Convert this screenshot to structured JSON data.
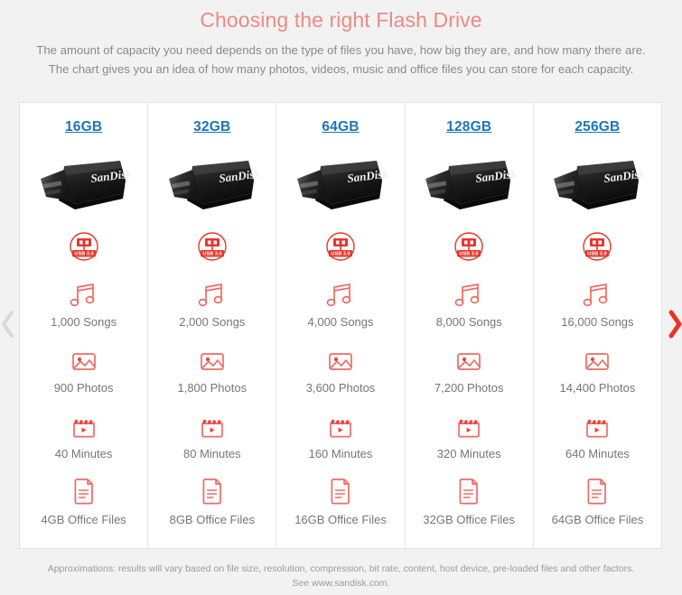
{
  "header": {
    "title": "Choosing the right Flash Drive",
    "subtitle_line1": "The amount of capacity you need depends on the type of files you have, how big they are, and how many there are.",
    "subtitle_line2": "The chart gives you an idea of how many photos, videos, music and office files you can store for each capacity."
  },
  "badge": {
    "usb_label": "USB 3.0"
  },
  "chart_data": {
    "type": "table",
    "title": "Choosing the right Flash Drive",
    "columns": [
      "16GB",
      "32GB",
      "64GB",
      "128GB",
      "256GB"
    ],
    "rows": [
      {
        "icon": "music-note-icon",
        "metric": "Songs",
        "values": [
          "1,000 Songs",
          "2,000 Songs",
          "4,000 Songs",
          "8,000 Songs",
          "16,000 Songs"
        ]
      },
      {
        "icon": "photo-icon",
        "metric": "Photos",
        "values": [
          "900 Photos",
          "1,800 Photos",
          "3,600 Photos",
          "7,200 Photos",
          "14,400 Photos"
        ]
      },
      {
        "icon": "video-clapperboard-icon",
        "metric": "Minutes",
        "values": [
          "40 Minutes",
          "80 Minutes",
          "160 Minutes",
          "320 Minutes",
          "640 Minutes"
        ]
      },
      {
        "icon": "document-icon",
        "metric": "Office Files",
        "values": [
          "4GB Office Files",
          "8GB Office Files",
          "16GB Office Files",
          "32GB Office Files",
          "64GB Office Files"
        ]
      }
    ]
  },
  "columns": [
    {
      "capacity": "16GB",
      "songs": "1,000 Songs",
      "photos": "900 Photos",
      "minutes": "40 Minutes",
      "office": "4GB Office Files"
    },
    {
      "capacity": "32GB",
      "songs": "2,000 Songs",
      "photos": "1,800 Photos",
      "minutes": "80 Minutes",
      "office": "8GB Office Files"
    },
    {
      "capacity": "64GB",
      "songs": "4,000 Songs",
      "photos": "3,600 Photos",
      "minutes": "160 Minutes",
      "office": "16GB Office Files"
    },
    {
      "capacity": "128GB",
      "songs": "8,000 Songs",
      "photos": "7,200 Photos",
      "minutes": "320 Minutes",
      "office": "32GB Office Files"
    },
    {
      "capacity": "256GB",
      "songs": "16,000 Songs",
      "photos": "14,400 Photos",
      "minutes": "640 Minutes",
      "office": "64GB Office Files"
    }
  ],
  "footnote": {
    "line1": "Approximations: results will vary based on file size, resolution, compression, bit rate, content, host device, pre-loaded files and other factors.",
    "line2": "See www.sandisk.com."
  },
  "colors": {
    "title": "#ec8a85",
    "icon_red": "#ef6b63",
    "badge_red": "#e8352c",
    "link_blue": "#1b75bb",
    "body_text": "#8a8a8a",
    "page_background": "#f2f2f2",
    "card_background": "#ffffff"
  }
}
